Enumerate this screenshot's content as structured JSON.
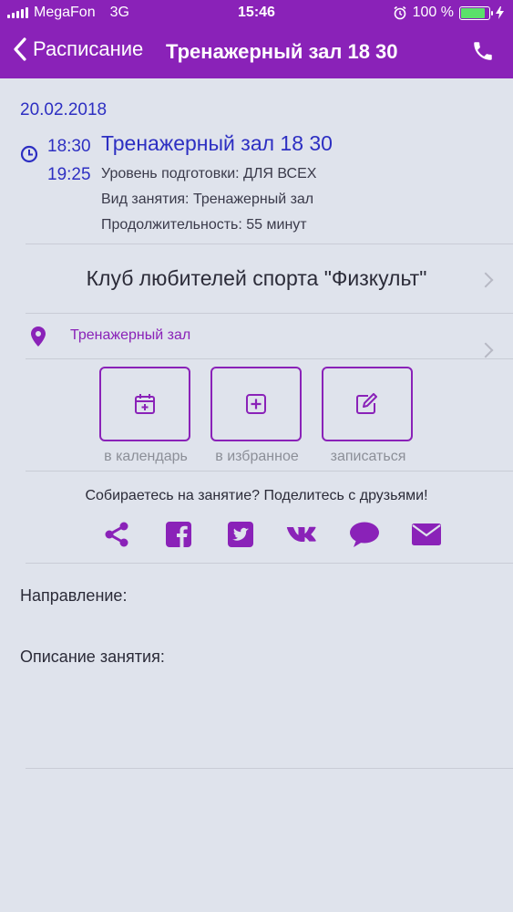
{
  "status_bar": {
    "carrier": "MegaFon",
    "network": "3G",
    "time": "15:46",
    "battery": "100 %"
  },
  "nav": {
    "back_label": "Расписание",
    "title": "Тренажерный зал 18 30"
  },
  "session": {
    "date": "20.02.2018",
    "start_time": "18:30",
    "end_time": "19:25",
    "title": "Тренажерный зал 18 30",
    "level": "Уровень подготовки: ДЛЯ ВСЕХ",
    "type": "Вид занятия: Тренажерный зал",
    "duration": "Продолжительность: 55 минут"
  },
  "club_name": "Клуб любителей спорта \"Физкульт\"",
  "location": "Тренажерный зал",
  "actions": [
    {
      "label": "в календарь",
      "icon": "calendar-plus-icon"
    },
    {
      "label": "в избранное",
      "icon": "plus-square-icon"
    },
    {
      "label": "записаться",
      "icon": "edit-icon"
    }
  ],
  "share": {
    "text": "Собираетесь на занятие? Поделитесь с друзьями!",
    "icons": [
      "share-icon",
      "facebook-icon",
      "twitter-icon",
      "vk-icon",
      "message-icon",
      "email-icon"
    ]
  },
  "sections": {
    "direction": "Направление:",
    "description": "Описание занятия:"
  },
  "colors": {
    "accent": "#8a22b8",
    "link_blue": "#2d2fc2",
    "background": "#dfe3ec"
  }
}
